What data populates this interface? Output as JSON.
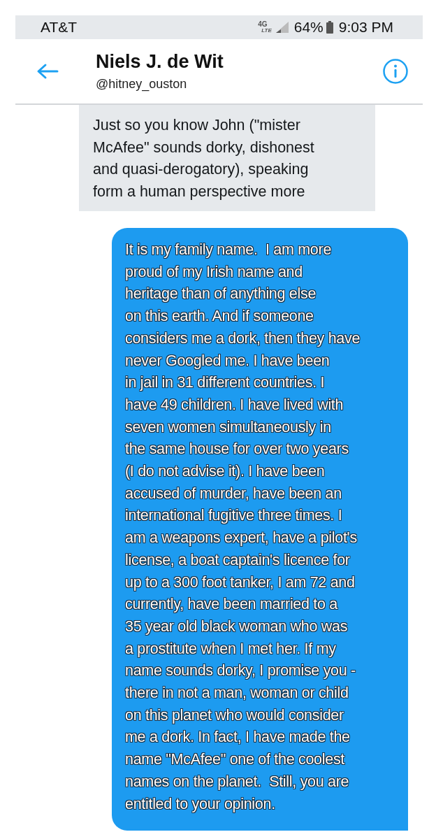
{
  "status_bar": {
    "carrier": "AT&T",
    "network": "4G",
    "network_sub": "LTE",
    "battery": "64%",
    "time": "9:03 PM"
  },
  "header": {
    "name": "Niels J. de Wit",
    "handle": "@hitney_ouston"
  },
  "messages": [
    {
      "kind": "received",
      "text": "Just so you know John (\"mister\nMcAfee\" sounds dorky, dishonest\nand quasi-derogatory), speaking\nform a human perspective more"
    },
    {
      "kind": "sent",
      "text": "It is my family name.  I am more\nproud of my Irish name and\nheritage than of anything else\non this earth. And if someone\nconsiders me a dork, then they have\nnever Googled me. I have been\nin jail in 31 different countries. I\nhave 49 children. I have lived with\nseven women simultaneously in\nthe same house for over two years\n(I do not advise it). I have been\naccused of murder, have been an\ninternational fugitive three times. I\nam a weapons expert, have a pilot's\nlicense, a boat captain's licence for\nup to a 300 foot tanker, I am 72 and\ncurrently, have been married to a\n35 year old black woman who was\na prostitute when I met her. If my\nname sounds dorky, I promise you -\nthere in not a man, woman or child\non this planet who would consider\nme a dork. In fact, I have made the\nname \"McAfee\" one of the coolest\nnames on the planet.  Still, you are\nentitled to your opinion."
    }
  ]
}
